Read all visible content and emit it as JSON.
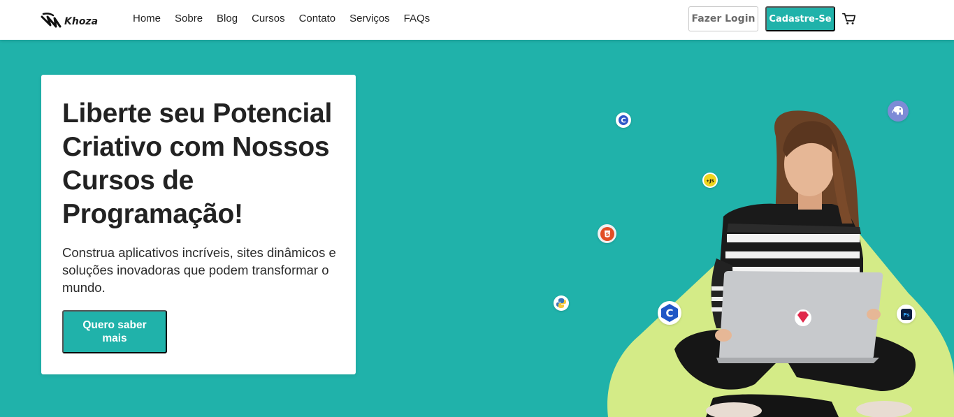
{
  "brand": {
    "name": "Khoza"
  },
  "nav": {
    "links": [
      "Home",
      "Sobre",
      "Blog",
      "Cursos",
      "Contato",
      "Serviços",
      "FAQs"
    ],
    "login_label": "Fazer Login",
    "signup_label": "Cadastre-Se",
    "cart_icon": "cart-icon"
  },
  "hero": {
    "title": "Liberte seu Potencial Criativo com Nossos Cursos de Programação!",
    "subtitle": "Construa aplicativos incríveis, sites dinâmicos e soluções inovadoras que podem transformar o mundo.",
    "cta_label": "Quero saber mais"
  },
  "tech_icons": [
    {
      "name": "c-icon",
      "label": "C"
    },
    {
      "name": "javascript-icon",
      "label": "+JS"
    },
    {
      "name": "html5-icon",
      "label": "5"
    },
    {
      "name": "python-icon"
    },
    {
      "name": "c-large-icon",
      "label": "C"
    },
    {
      "name": "php-elephant-icon"
    },
    {
      "name": "photoshop-icon",
      "label": "Ps"
    },
    {
      "name": "ruby-icon"
    }
  ],
  "colors": {
    "primary": "#20b2aa",
    "accent_shape": "#d4eb87",
    "text": "#222222"
  }
}
